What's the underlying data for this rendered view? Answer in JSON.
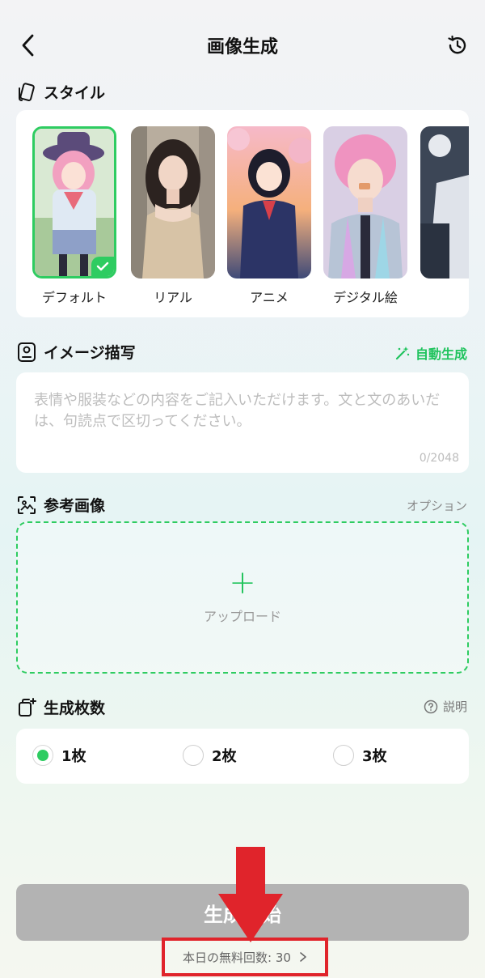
{
  "header": {
    "title": "画像生成"
  },
  "style_section": {
    "label": "スタイル",
    "items": [
      {
        "label": "デフォルト",
        "selected": true
      },
      {
        "label": "リアル",
        "selected": false
      },
      {
        "label": "アニメ",
        "selected": false
      },
      {
        "label": "デジタル絵",
        "selected": false
      },
      {
        "label": "",
        "selected": false
      }
    ]
  },
  "description_section": {
    "label": "イメージ描写",
    "auto_generate": "自動生成",
    "placeholder": "表情や服装などの内容をご記入いただけます。文と文のあいだは、句読点で区切ってください。",
    "counter": "0/2048"
  },
  "reference_section": {
    "label": "参考画像",
    "option": "オプション",
    "upload_label": "アップロード"
  },
  "count_section": {
    "label": "生成枚数",
    "explain": "説明",
    "options": [
      {
        "label": "1枚",
        "selected": true
      },
      {
        "label": "2枚",
        "selected": false
      },
      {
        "label": "3枚",
        "selected": false
      }
    ]
  },
  "generate_button": {
    "label": "生成開始"
  },
  "free_count": {
    "label": "本日の無料回数: 30"
  },
  "colors": {
    "accent": "#2ecc61",
    "highlight": "#e0242b",
    "button_disabled": "#b3b3b3"
  }
}
